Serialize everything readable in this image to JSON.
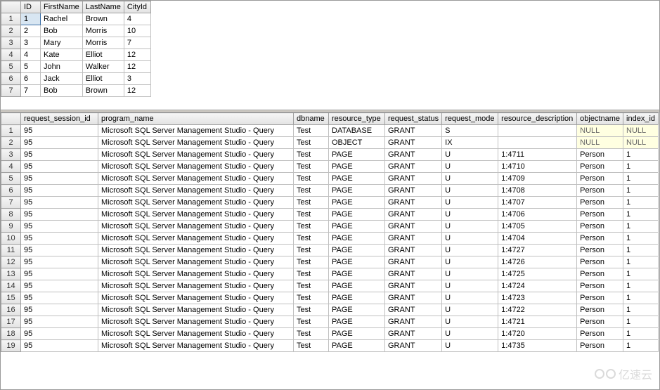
{
  "top_grid": {
    "columns": [
      "ID",
      "FirstName",
      "LastName",
      "CityId"
    ],
    "rows": [
      {
        "n": "1",
        "ID": "1",
        "FirstName": "Rachel",
        "LastName": "Brown",
        "CityId": "4"
      },
      {
        "n": "2",
        "ID": "2",
        "FirstName": "Bob",
        "LastName": "Morris",
        "CityId": "10"
      },
      {
        "n": "3",
        "ID": "3",
        "FirstName": "Mary",
        "LastName": "Morris",
        "CityId": "7"
      },
      {
        "n": "4",
        "ID": "4",
        "FirstName": "Kate",
        "LastName": "Elliot",
        "CityId": "12"
      },
      {
        "n": "5",
        "ID": "5",
        "FirstName": "John",
        "LastName": "Walker",
        "CityId": "12"
      },
      {
        "n": "6",
        "ID": "6",
        "FirstName": "Jack",
        "LastName": "Elliot",
        "CityId": "3"
      },
      {
        "n": "7",
        "ID": "7",
        "FirstName": "Bob",
        "LastName": "Brown",
        "CityId": "12"
      }
    ],
    "selected_row": 0,
    "selected_col": "ID"
  },
  "bottom_grid": {
    "columns": [
      "request_session_id",
      "program_name",
      "dbname",
      "resource_type",
      "request_status",
      "request_mode",
      "resource_description",
      "objectname",
      "index_id"
    ],
    "rows": [
      {
        "n": "1",
        "request_session_id": "95",
        "program_name": "Microsoft SQL Server Management Studio - Query",
        "dbname": "Test",
        "resource_type": "DATABASE",
        "request_status": "GRANT",
        "request_mode": "S",
        "resource_description": "",
        "objectname": "NULL",
        "index_id": "NULL"
      },
      {
        "n": "2",
        "request_session_id": "95",
        "program_name": "Microsoft SQL Server Management Studio - Query",
        "dbname": "Test",
        "resource_type": "OBJECT",
        "request_status": "GRANT",
        "request_mode": "IX",
        "resource_description": "",
        "objectname": "NULL",
        "index_id": "NULL"
      },
      {
        "n": "3",
        "request_session_id": "95",
        "program_name": "Microsoft SQL Server Management Studio - Query",
        "dbname": "Test",
        "resource_type": "PAGE",
        "request_status": "GRANT",
        "request_mode": "U",
        "resource_description": "1:4711",
        "objectname": "Person",
        "index_id": "1"
      },
      {
        "n": "4",
        "request_session_id": "95",
        "program_name": "Microsoft SQL Server Management Studio - Query",
        "dbname": "Test",
        "resource_type": "PAGE",
        "request_status": "GRANT",
        "request_mode": "U",
        "resource_description": "1:4710",
        "objectname": "Person",
        "index_id": "1"
      },
      {
        "n": "5",
        "request_session_id": "95",
        "program_name": "Microsoft SQL Server Management Studio - Query",
        "dbname": "Test",
        "resource_type": "PAGE",
        "request_status": "GRANT",
        "request_mode": "U",
        "resource_description": "1:4709",
        "objectname": "Person",
        "index_id": "1"
      },
      {
        "n": "6",
        "request_session_id": "95",
        "program_name": "Microsoft SQL Server Management Studio - Query",
        "dbname": "Test",
        "resource_type": "PAGE",
        "request_status": "GRANT",
        "request_mode": "U",
        "resource_description": "1:4708",
        "objectname": "Person",
        "index_id": "1"
      },
      {
        "n": "7",
        "request_session_id": "95",
        "program_name": "Microsoft SQL Server Management Studio - Query",
        "dbname": "Test",
        "resource_type": "PAGE",
        "request_status": "GRANT",
        "request_mode": "U",
        "resource_description": "1:4707",
        "objectname": "Person",
        "index_id": "1"
      },
      {
        "n": "8",
        "request_session_id": "95",
        "program_name": "Microsoft SQL Server Management Studio - Query",
        "dbname": "Test",
        "resource_type": "PAGE",
        "request_status": "GRANT",
        "request_mode": "U",
        "resource_description": "1:4706",
        "objectname": "Person",
        "index_id": "1"
      },
      {
        "n": "9",
        "request_session_id": "95",
        "program_name": "Microsoft SQL Server Management Studio - Query",
        "dbname": "Test",
        "resource_type": "PAGE",
        "request_status": "GRANT",
        "request_mode": "U",
        "resource_description": "1:4705",
        "objectname": "Person",
        "index_id": "1"
      },
      {
        "n": "10",
        "request_session_id": "95",
        "program_name": "Microsoft SQL Server Management Studio - Query",
        "dbname": "Test",
        "resource_type": "PAGE",
        "request_status": "GRANT",
        "request_mode": "U",
        "resource_description": "1:4704",
        "objectname": "Person",
        "index_id": "1"
      },
      {
        "n": "11",
        "request_session_id": "95",
        "program_name": "Microsoft SQL Server Management Studio - Query",
        "dbname": "Test",
        "resource_type": "PAGE",
        "request_status": "GRANT",
        "request_mode": "U",
        "resource_description": "1:4727",
        "objectname": "Person",
        "index_id": "1"
      },
      {
        "n": "12",
        "request_session_id": "95",
        "program_name": "Microsoft SQL Server Management Studio - Query",
        "dbname": "Test",
        "resource_type": "PAGE",
        "request_status": "GRANT",
        "request_mode": "U",
        "resource_description": "1:4726",
        "objectname": "Person",
        "index_id": "1"
      },
      {
        "n": "13",
        "request_session_id": "95",
        "program_name": "Microsoft SQL Server Management Studio - Query",
        "dbname": "Test",
        "resource_type": "PAGE",
        "request_status": "GRANT",
        "request_mode": "U",
        "resource_description": "1:4725",
        "objectname": "Person",
        "index_id": "1"
      },
      {
        "n": "14",
        "request_session_id": "95",
        "program_name": "Microsoft SQL Server Management Studio - Query",
        "dbname": "Test",
        "resource_type": "PAGE",
        "request_status": "GRANT",
        "request_mode": "U",
        "resource_description": "1:4724",
        "objectname": "Person",
        "index_id": "1"
      },
      {
        "n": "15",
        "request_session_id": "95",
        "program_name": "Microsoft SQL Server Management Studio - Query",
        "dbname": "Test",
        "resource_type": "PAGE",
        "request_status": "GRANT",
        "request_mode": "U",
        "resource_description": "1:4723",
        "objectname": "Person",
        "index_id": "1"
      },
      {
        "n": "16",
        "request_session_id": "95",
        "program_name": "Microsoft SQL Server Management Studio - Query",
        "dbname": "Test",
        "resource_type": "PAGE",
        "request_status": "GRANT",
        "request_mode": "U",
        "resource_description": "1:4722",
        "objectname": "Person",
        "index_id": "1"
      },
      {
        "n": "17",
        "request_session_id": "95",
        "program_name": "Microsoft SQL Server Management Studio - Query",
        "dbname": "Test",
        "resource_type": "PAGE",
        "request_status": "GRANT",
        "request_mode": "U",
        "resource_description": "1:4721",
        "objectname": "Person",
        "index_id": "1"
      },
      {
        "n": "18",
        "request_session_id": "95",
        "program_name": "Microsoft SQL Server Management Studio - Query",
        "dbname": "Test",
        "resource_type": "PAGE",
        "request_status": "GRANT",
        "request_mode": "U",
        "resource_description": "1:4720",
        "objectname": "Person",
        "index_id": "1"
      },
      {
        "n": "19",
        "request_session_id": "95",
        "program_name": "Microsoft SQL Server Management Studio - Query",
        "dbname": "Test",
        "resource_type": "PAGE",
        "request_status": "GRANT",
        "request_mode": "U",
        "resource_description": "1:4735",
        "objectname": "Person",
        "index_id": "1"
      }
    ]
  },
  "watermark_text": "亿速云"
}
